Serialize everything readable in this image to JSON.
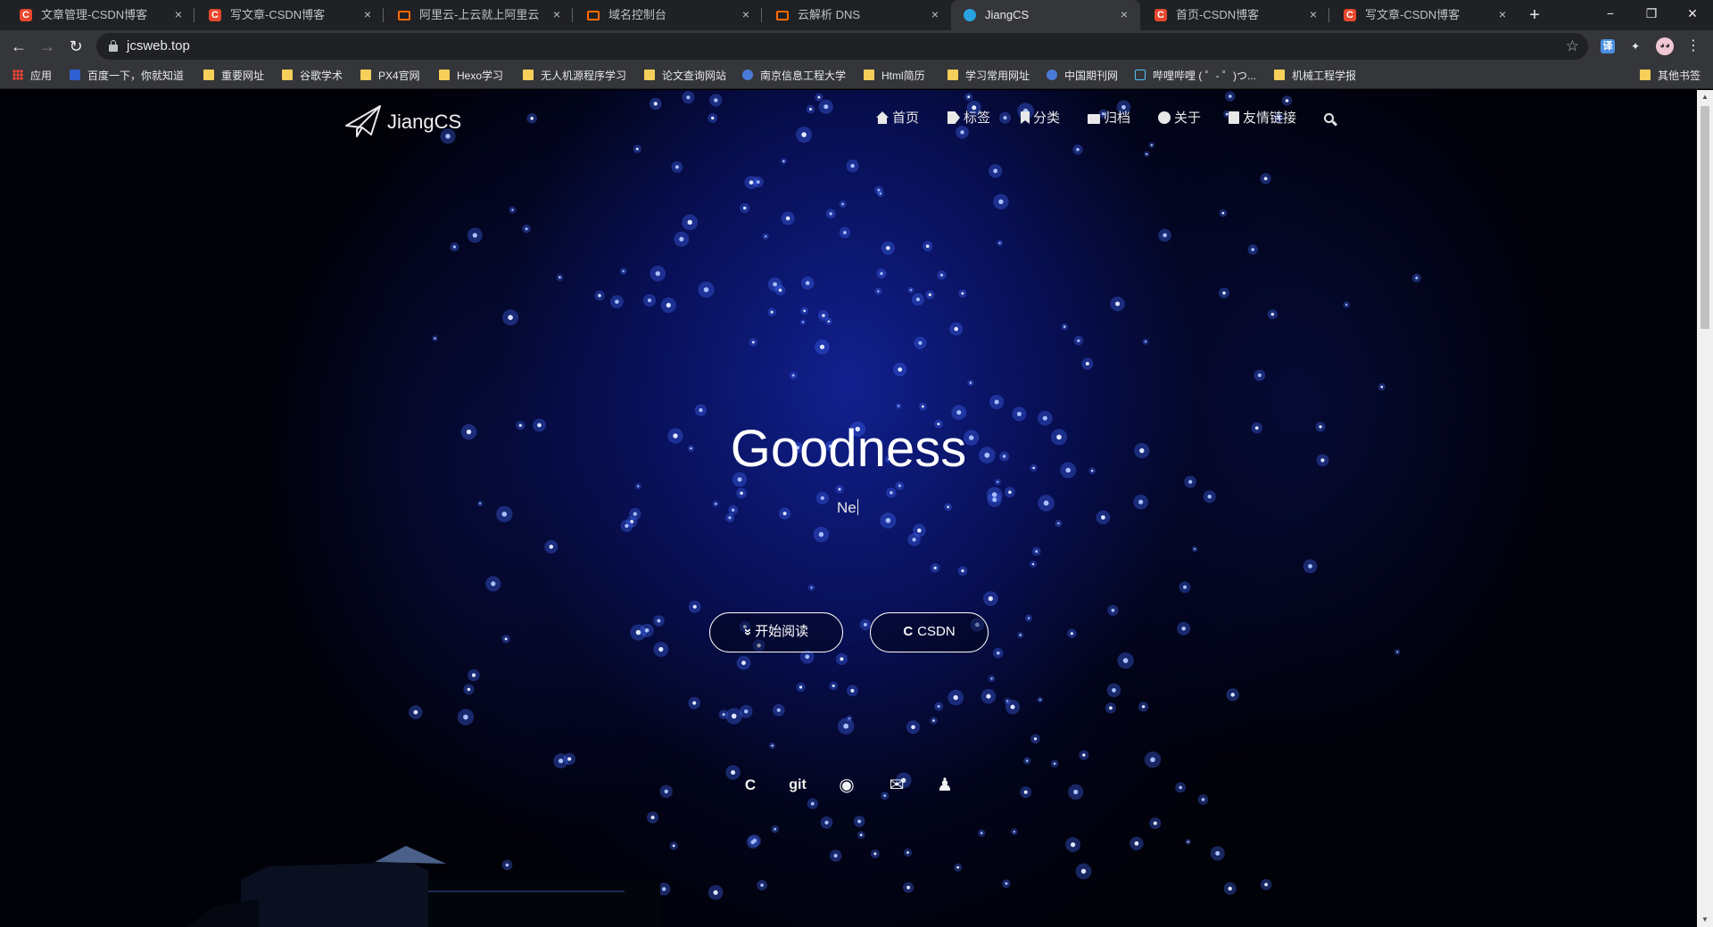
{
  "browser": {
    "tabs": [
      {
        "favicon": "csdn",
        "title": "文章管理-CSDN博客",
        "active": false
      },
      {
        "favicon": "csdn",
        "title": "写文章-CSDN博客",
        "active": false
      },
      {
        "favicon": "aliyun",
        "title": "阿里云-上云就上阿里云",
        "active": false
      },
      {
        "favicon": "aliyun",
        "title": "域名控制台",
        "active": false
      },
      {
        "favicon": "aliyun",
        "title": "云解析 DNS",
        "active": false
      },
      {
        "favicon": "globe",
        "title": "JiangCS",
        "active": true
      },
      {
        "favicon": "csdn",
        "title": "首页-CSDN博客",
        "active": false
      },
      {
        "favicon": "csdn",
        "title": "写文章-CSDN博客",
        "active": false
      }
    ],
    "close_glyph": "×",
    "newtab_glyph": "+",
    "window_controls": {
      "minimize": "−",
      "maximize": "❐",
      "close": "✕"
    },
    "nav": {
      "back": "←",
      "forward": "→",
      "reload": "↻"
    },
    "url": "jcsweb.top",
    "star_glyph": "☆",
    "extensions": {
      "translate": "译",
      "puzzle": "✦",
      "avatar": "◕◕",
      "menu": "⋮"
    },
    "bookmarks": [
      {
        "icon": "apps",
        "label": "应用"
      },
      {
        "icon": "paw",
        "label": "百度一下，你就知道"
      },
      {
        "icon": "folder",
        "label": "重要网址"
      },
      {
        "icon": "folder",
        "label": "谷歌学术"
      },
      {
        "icon": "folder",
        "label": "PX4官网"
      },
      {
        "icon": "folder",
        "label": "Hexo学习"
      },
      {
        "icon": "folder",
        "label": "无人机源程序学习"
      },
      {
        "icon": "folder",
        "label": "论文查询网站"
      },
      {
        "icon": "site",
        "label": "南京信息工程大学"
      },
      {
        "icon": "folder",
        "label": "Html简历"
      },
      {
        "icon": "folder",
        "label": "学习常用网址"
      },
      {
        "icon": "site",
        "label": "中国期刊网"
      },
      {
        "icon": "tv",
        "label": "哔哩哔哩 ( ゜- ゜)つ..."
      },
      {
        "icon": "folder",
        "label": "机械工程学报"
      },
      {
        "icon": "folder",
        "label": "其他书签"
      }
    ]
  },
  "site": {
    "logo_text": "JiangCS",
    "nav": [
      {
        "icon": "home-icon",
        "label": "首页"
      },
      {
        "icon": "tags-icon",
        "label": "标签"
      },
      {
        "icon": "bookmark-icon",
        "label": "分类"
      },
      {
        "icon": "archive-icon",
        "label": "归档"
      },
      {
        "icon": "info-icon",
        "label": "关于"
      },
      {
        "icon": "address-book-icon",
        "label": "友情链接"
      }
    ],
    "hero_title": "Goodness",
    "hero_subtitle": "Ne",
    "buttons": {
      "read": {
        "icon": "»",
        "label": "开始阅读"
      },
      "csdn": {
        "icon": "C",
        "label": "CSDN"
      }
    },
    "social": [
      {
        "name": "csdn",
        "glyph": "C"
      },
      {
        "name": "git",
        "glyph": "git"
      },
      {
        "name": "github",
        "glyph": "◉"
      },
      {
        "name": "email",
        "glyph": "✉"
      },
      {
        "name": "qq",
        "glyph": "♟"
      }
    ]
  },
  "colors": {
    "tab_bg": "#202124",
    "active_tab_bg": "#35363a",
    "hero_blue": "#12229a",
    "page_bg": "#010108"
  }
}
